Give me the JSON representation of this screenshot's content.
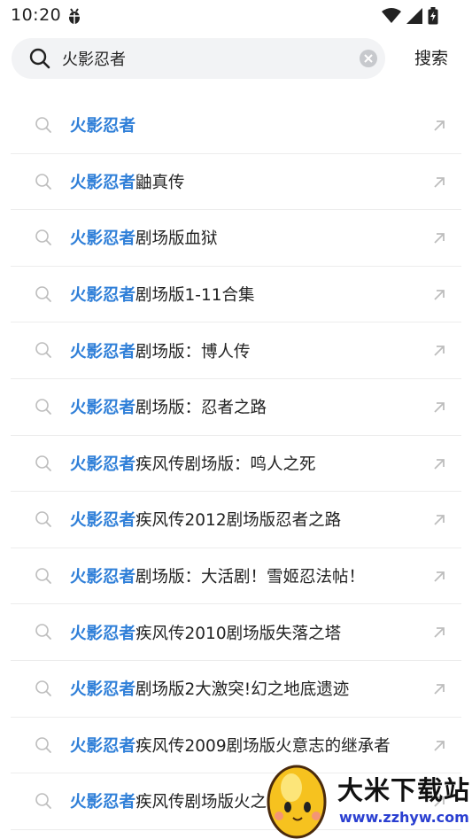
{
  "status_bar": {
    "time": "10:20",
    "notification_icon": "bug-icon",
    "wifi_icon": "wifi-icon",
    "signal_icon": "signal-icon",
    "battery_icon": "battery-charging-icon"
  },
  "search": {
    "value": "火影忍者",
    "placeholder": "",
    "button_label": "搜索"
  },
  "suggestions": [
    {
      "keyword": "火影忍者",
      "rest": ""
    },
    {
      "keyword": "火影忍者",
      "rest": "鼬真传"
    },
    {
      "keyword": "火影忍者",
      "rest": "剧场版血狱"
    },
    {
      "keyword": "火影忍者",
      "rest": "剧场版1-11合集"
    },
    {
      "keyword": "火影忍者",
      "rest": "剧场版：博人传"
    },
    {
      "keyword": "火影忍者",
      "rest": "剧场版：忍者之路"
    },
    {
      "keyword": "火影忍者",
      "rest": "疾风传剧场版：鸣人之死"
    },
    {
      "keyword": "火影忍者",
      "rest": "疾风传2012剧场版忍者之路"
    },
    {
      "keyword": "火影忍者",
      "rest": "剧场版：大活剧！雪姬忍法帖！"
    },
    {
      "keyword": "火影忍者",
      "rest": "疾风传2010剧场版失落之塔"
    },
    {
      "keyword": "火影忍者",
      "rest": "剧场版2大激突!幻之地底遗迹"
    },
    {
      "keyword": "火影忍者",
      "rest": "疾风传2009剧场版火意志的继承者"
    },
    {
      "keyword": "火影忍者",
      "rest": "疾风传剧场版火之"
    }
  ],
  "watermark": {
    "title": "大米下载站",
    "url": "www.zzhyw.com"
  },
  "colors": {
    "keyword_highlight": "#2f7fd8",
    "search_bg": "#f2f3f5",
    "divider": "#ececec"
  }
}
